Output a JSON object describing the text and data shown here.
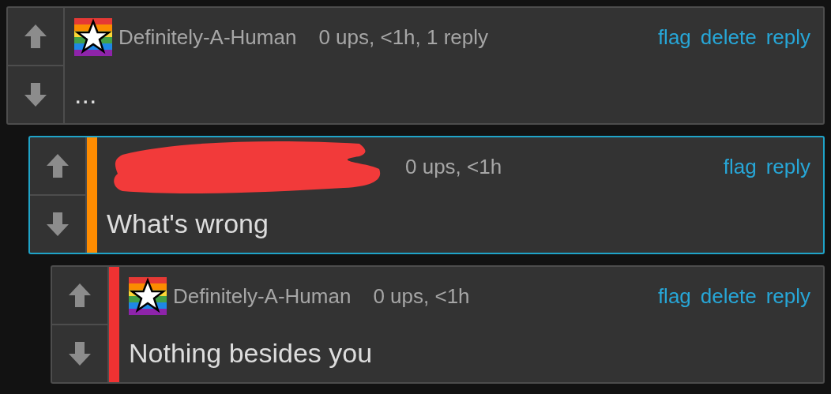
{
  "comments": [
    {
      "author": "Definitely-A-Human",
      "avatar": true,
      "meta": "0 ups, <1h, 1 reply",
      "actions": [
        "flag",
        "delete",
        "reply"
      ],
      "body": "...",
      "highlighted": false,
      "children": [
        {
          "author_redacted": true,
          "avatar": false,
          "meta": "0 ups, <1h",
          "actions": [
            "flag",
            "reply"
          ],
          "body": "What's wrong",
          "highlighted": true,
          "color": "#ff8c00",
          "children": [
            {
              "author": "Definitely-A-Human",
              "avatar": true,
              "meta": "0 ups, <1h",
              "actions": [
                "flag",
                "delete",
                "reply"
              ],
              "body": "Nothing besides you",
              "highlighted": false,
              "color": "#f03232"
            }
          ]
        }
      ]
    }
  ]
}
